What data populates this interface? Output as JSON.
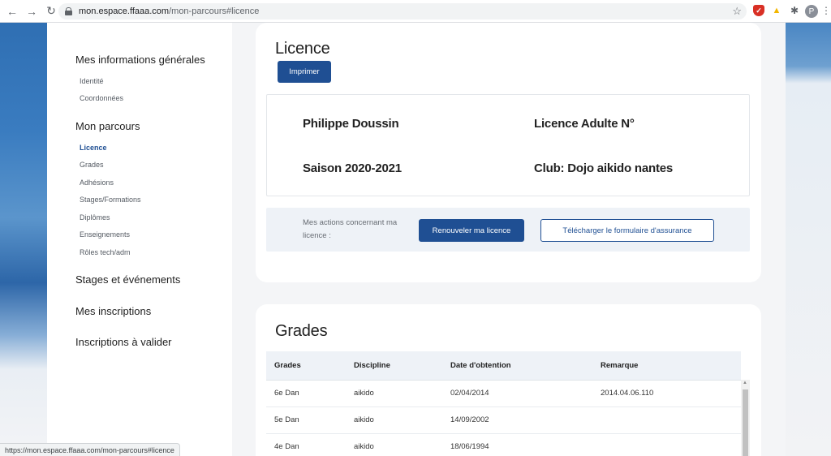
{
  "browser": {
    "url_host": "mon.espace.ffaaa.com",
    "url_path": "/mon-parcours#licence",
    "avatar_initial": "P",
    "status_url": "https://mon.espace.ffaaa.com/mon-parcours#licence"
  },
  "sidebar": {
    "section_general": "Mes informations générales",
    "general_items": [
      "Identité",
      "Coordonnées"
    ],
    "section_parcours": "Mon parcours",
    "parcours_items": [
      "Licence",
      "Grades",
      "Adhésions",
      "Stages/Formations",
      "Diplômes",
      "Enseignements",
      "Rôles tech/adm"
    ],
    "section_stages": "Stages et événements",
    "section_inscriptions": "Mes inscriptions",
    "section_valider": "Inscriptions à valider"
  },
  "licence": {
    "title": "Licence",
    "print_label": "Imprimer",
    "name": "Philippe Doussin",
    "type": "Licence Adulte N°",
    "season": "Saison 2020-2021",
    "club": "Club: Dojo aikido nantes",
    "actions_label": "Mes actions concernant ma licence :",
    "renew_label": "Renouveler ma licence",
    "download_label": "Télécharger le formulaire d'assurance"
  },
  "grades": {
    "title": "Grades",
    "columns": [
      "Grades",
      "Discipline",
      "Date d'obtention",
      "Remarque"
    ],
    "rows": [
      [
        "6e Dan",
        "aikido",
        "02/04/2014",
        "2014.04.06.110"
      ],
      [
        "5e Dan",
        "aikido",
        "14/09/2002",
        ""
      ],
      [
        "4e Dan",
        "aikido",
        "18/06/1994",
        ""
      ]
    ]
  }
}
